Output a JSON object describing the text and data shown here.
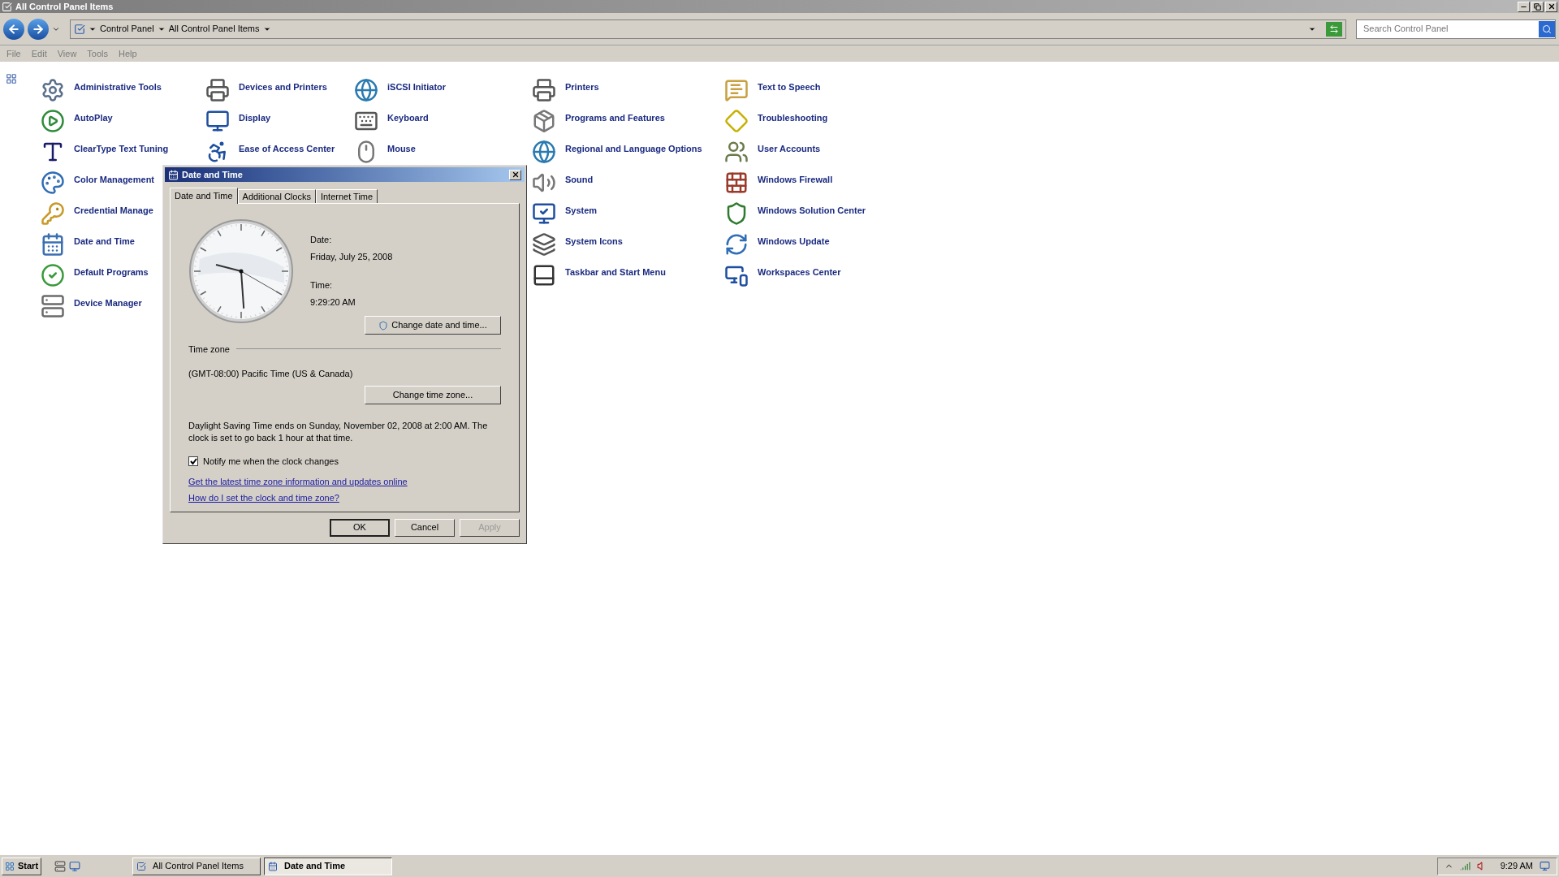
{
  "window": {
    "title": "All Control Panel Items"
  },
  "address": {
    "breadcrumbs": [
      "Control Panel",
      "All Control Panel Items"
    ]
  },
  "search": {
    "placeholder": "Search Control Panel"
  },
  "menu": [
    "File",
    "Edit",
    "View",
    "Tools",
    "Help"
  ],
  "columns": [
    {
      "items": [
        "Administrative Tools",
        "AutoPlay",
        "ClearType Text Tuning",
        "Color Management",
        "Credential Manage",
        "Date and Time",
        "Default Programs",
        "Device Manager"
      ]
    },
    {
      "items": [
        "Devices and Printers",
        "Display",
        "Ease of Access Center"
      ]
    },
    {
      "items": [
        "iSCSI Initiator",
        "Keyboard",
        "Mouse"
      ]
    },
    {
      "items": [
        "Printers",
        "Programs and Features",
        "Regional and Language Options",
        "Sound",
        "System",
        "System Icons",
        "Taskbar and Start Menu"
      ]
    },
    {
      "items": [
        "Text to Speech",
        "Troubleshooting",
        "User Accounts",
        "Windows Firewall",
        "Windows Solution Center",
        "Windows Update",
        "Workspaces Center"
      ]
    }
  ],
  "dialog": {
    "title": "Date and Time",
    "tabs": [
      {
        "label": "Date and Time",
        "selected": true
      },
      {
        "label": "Additional Clocks",
        "selected": false
      },
      {
        "label": "Internet Time",
        "selected": false
      }
    ],
    "date_label": "Date:",
    "date": "Friday, July 25, 2008",
    "time_label": "Time:",
    "time": "9:29:20 AM",
    "change_datetime_button": "Change date and time...",
    "timezone_heading": "Time zone",
    "timezone": "(GMT-08:00) Pacific Time (US & Canada)",
    "change_timezone_button": "Change time zone...",
    "dst_note": "Daylight Saving Time ends on Sunday, November 02, 2008 at 2:00 AM. The clock is set to go back 1 hour at that time.",
    "notify": {
      "label": "Notify me when the clock changes",
      "checked": true
    },
    "links": [
      "Get the latest time zone information and updates online",
      "How do I set the clock and time zone?"
    ],
    "buttons": [
      {
        "label": "OK",
        "disabled": false,
        "default": true
      },
      {
        "label": "Cancel",
        "disabled": false,
        "default": false
      },
      {
        "label": "Apply",
        "disabled": true,
        "default": false
      }
    ]
  },
  "taskbar": {
    "start": "Start",
    "tasks": [
      {
        "label": "All Control Panel Items",
        "selected": false
      },
      {
        "label": "Date and Time",
        "selected": true
      }
    ],
    "time": "9:29 AM"
  }
}
